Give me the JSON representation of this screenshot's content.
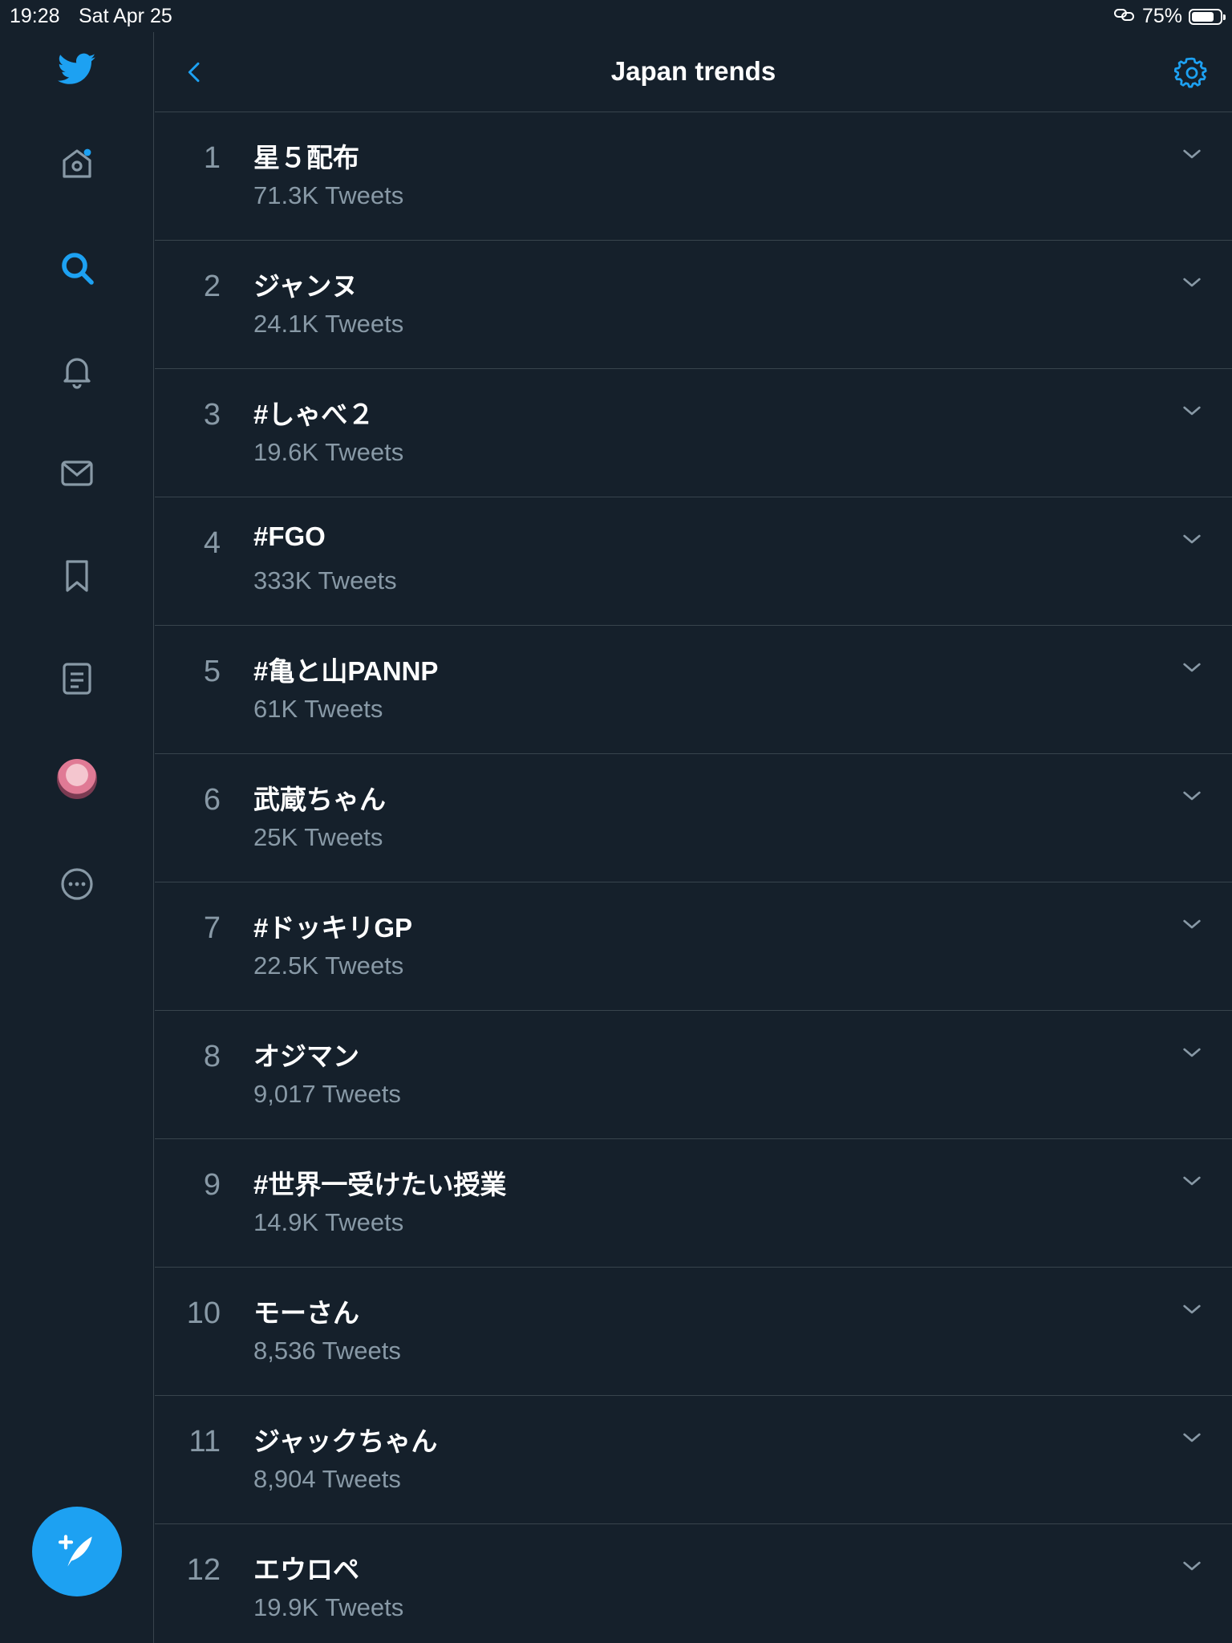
{
  "status_bar": {
    "time": "19:28",
    "date": "Sat Apr 25",
    "battery": "75%"
  },
  "header": {
    "title": "Japan trends"
  },
  "colors": {
    "background": "#15202b",
    "accent": "#1da1f2",
    "divider": "#38444d",
    "secondary_text": "#8899a6"
  },
  "sidebar": {
    "items": [
      {
        "icon": "twitter-logo-icon"
      },
      {
        "icon": "home-icon",
        "has_notification_dot": true
      },
      {
        "icon": "search-icon",
        "active": true
      },
      {
        "icon": "bell-icon"
      },
      {
        "icon": "mail-icon"
      },
      {
        "icon": "bookmark-icon"
      },
      {
        "icon": "lists-icon"
      },
      {
        "icon": "avatar"
      },
      {
        "icon": "more-icon"
      }
    ],
    "compose_icon": "compose-icon"
  },
  "trends": [
    {
      "rank": "1",
      "name": "星５配布",
      "count": "71.3K Tweets"
    },
    {
      "rank": "2",
      "name": "ジャンヌ",
      "count": "24.1K Tweets"
    },
    {
      "rank": "3",
      "name": "#しゃべ２",
      "count": "19.6K Tweets"
    },
    {
      "rank": "4",
      "name": "#FGO",
      "count": "333K Tweets"
    },
    {
      "rank": "5",
      "name": "#亀と山PANNP",
      "count": "61K Tweets"
    },
    {
      "rank": "6",
      "name": "武蔵ちゃん",
      "count": "25K Tweets"
    },
    {
      "rank": "7",
      "name": "#ドッキリGP",
      "count": "22.5K Tweets"
    },
    {
      "rank": "8",
      "name": "オジマン",
      "count": "9,017 Tweets"
    },
    {
      "rank": "9",
      "name": "#世界一受けたい授業",
      "count": "14.9K Tweets"
    },
    {
      "rank": "10",
      "name": "モーさん",
      "count": "8,536 Tweets"
    },
    {
      "rank": "11",
      "name": "ジャックちゃん",
      "count": "8,904 Tweets"
    },
    {
      "rank": "12",
      "name": "エウロペ",
      "count": "19.9K Tweets"
    }
  ]
}
